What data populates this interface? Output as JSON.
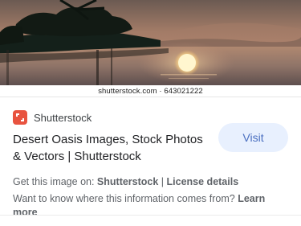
{
  "image": {
    "watermark": "shutterstock.com · 643021222",
    "alt": "Desert oasis with palm tree silhouette and setting sun reflected in water"
  },
  "source": {
    "name": "Shutterstock",
    "logo_icon": "shutterstock-logo-icon",
    "logo_color": "#e8533f"
  },
  "title": "Desert Oasis Images, Stock Photos & Vectors | Shutterstock",
  "visit_label": "Visit",
  "get_image": {
    "prefix": "Get this image on: ",
    "source": "Shutterstock",
    "separator": " | ",
    "license": "License details"
  },
  "know_more": {
    "text": "Want to know where this information comes from? ",
    "link": "Learn more"
  },
  "colors": {
    "visit_bg": "#e8f0fe",
    "visit_text": "#4a6fc0",
    "text_secondary": "#5f6368"
  }
}
